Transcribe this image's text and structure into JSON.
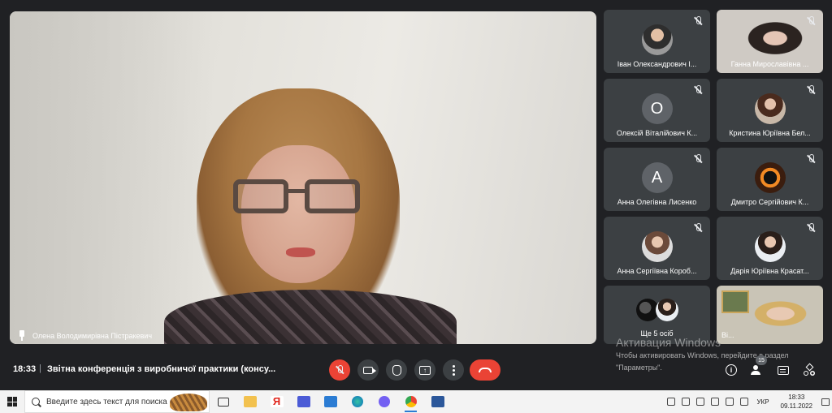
{
  "main_speaker": {
    "name": "Олена Володимирівна Пістракевич"
  },
  "tiles": [
    {
      "name": "Іван Олександрович І...",
      "avatar_type": "photo"
    },
    {
      "name": "Ганна Мирославівна ...",
      "avatar_type": "video"
    },
    {
      "name": "Олексій Віталійович К...",
      "avatar_letter": "О"
    },
    {
      "name": "Кристина Юріївна Бел...",
      "avatar_type": "photo"
    },
    {
      "name": "Анна Олегівна Лисенко",
      "avatar_letter": "А"
    },
    {
      "name": "Дмитро Сергійович К...",
      "avatar_type": "photo"
    },
    {
      "name": "Анна Сергіївна Короб...",
      "avatar_type": "photo"
    },
    {
      "name": "Дарія Юріївна Красат...",
      "avatar_type": "photo"
    },
    {
      "name": "Ще 5 осіб",
      "avatar_type": "group"
    },
    {
      "name": "Ві...",
      "avatar_type": "video"
    }
  ],
  "watermark": {
    "title": "Активация Windows",
    "line1": "Чтобы активировать Windows, перейдите в раздел",
    "line2": "\"Параметры\"."
  },
  "controls": {
    "time": "18:33",
    "separator": "|",
    "meeting_title": "Звітна конференція з виробничої практики (консу...",
    "participants_count": "15",
    "present_glyph": "↑"
  },
  "taskbar": {
    "search_placeholder": "Введите здесь текст для поиска",
    "language": "УКР",
    "clock_time": "18:33",
    "clock_date": "09.11.2022",
    "apps": [
      "task-view",
      "file-explorer",
      "yandex",
      "notes",
      "mail",
      "edge",
      "viber",
      "chrome",
      "word"
    ]
  },
  "colors": {
    "background": "#202124",
    "tile": "#3c4043",
    "danger": "#ea4335",
    "taskbar": "#f3f3f3"
  }
}
